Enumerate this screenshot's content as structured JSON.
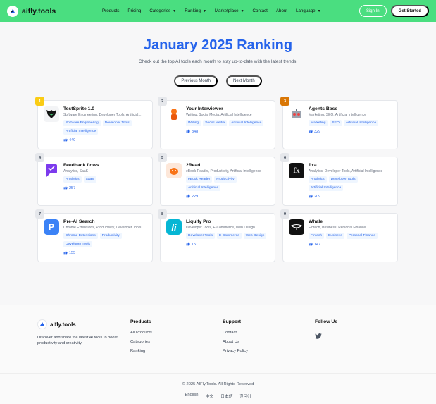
{
  "brand": {
    "name": "aifly.tools"
  },
  "nav": {
    "items": [
      {
        "label": "Products",
        "has_caret": false
      },
      {
        "label": "Pricing",
        "has_caret": false
      },
      {
        "label": "Categories",
        "has_caret": true
      },
      {
        "label": "Ranking",
        "has_caret": true
      },
      {
        "label": "Marketplace",
        "has_caret": true
      },
      {
        "label": "Contact",
        "has_caret": false
      },
      {
        "label": "About",
        "has_caret": false
      },
      {
        "label": "Language",
        "has_caret": true
      }
    ],
    "signin_label": "Sign In",
    "start_label": "Get Started"
  },
  "hero": {
    "title": "January 2025 Ranking",
    "subtitle": "Check out the top AI tools each month to stay up-to-date with the latest trends.",
    "prev_label": "Previous Month",
    "next_label": "Next Month"
  },
  "tools": [
    {
      "rank": "1",
      "name": "TestSprite 1.0",
      "categories": "Software Engineering, Developer Tools, Artificial...",
      "tags": [
        "Software Engineering",
        "Developer Tools",
        "Artificial Intelligence"
      ],
      "likes": "440",
      "icon": "testsprite-icon"
    },
    {
      "rank": "2",
      "name": "Your Interviewer",
      "categories": "Writing, Social Media, Artificial Intelligence",
      "tags": [
        "Writing",
        "Social Media",
        "Artificial Intelligence"
      ],
      "likes": "348",
      "icon": "interviewer-icon"
    },
    {
      "rank": "3",
      "name": "Agents Base",
      "categories": "Marketing, SEO, Artificial Intelligence",
      "tags": [
        "Marketing",
        "SEO",
        "Artificial Intelligence"
      ],
      "likes": "329",
      "icon": "robot-icon"
    },
    {
      "rank": "4",
      "name": "Feedback flows",
      "categories": "Analytics, SaaS",
      "tags": [
        "Analytics",
        "SaaS"
      ],
      "likes": "257",
      "icon": "feedback-icon"
    },
    {
      "rank": "5",
      "name": "2Read",
      "categories": "eBook Reader, Productivity, Artificial Intelligence",
      "tags": [
        "eBook Reader",
        "Productivity",
        "Artificial Intelligence"
      ],
      "likes": "229",
      "icon": "2read-icon"
    },
    {
      "rank": "6",
      "name": "fixa",
      "categories": "Analytics, Developer Tools, Artificial Intelligence",
      "tags": [
        "Analytics",
        "Developer Tools",
        "Artificial Intelligence"
      ],
      "likes": "209",
      "icon": "fixa-icon"
    },
    {
      "rank": "7",
      "name": "Pre-AI Search",
      "categories": "Chrome Extensions, Productivity, Developer Tools",
      "tags": [
        "Chrome Extensions",
        "Productivity",
        "Developer Tools"
      ],
      "likes": "155",
      "icon": "preai-icon"
    },
    {
      "rank": "8",
      "name": "Liquify Pro",
      "categories": "Developer Tools, E-Commerce, Web Design",
      "tags": [
        "Developer Tools",
        "E-Commerce",
        "Web Design"
      ],
      "likes": "151",
      "icon": "liquify-icon"
    },
    {
      "rank": "9",
      "name": "Whale",
      "categories": "Fintech, Business, Personal Finance",
      "tags": [
        "Fintech",
        "Business",
        "Personal Finance"
      ],
      "likes": "147",
      "icon": "whale-icon"
    }
  ],
  "footer": {
    "brand": "aifly.tools",
    "description": "Discover and share the latest AI tools to boost productivity and creativity.",
    "products_head": "Products",
    "products_links": [
      "All Products",
      "Categories",
      "Ranking"
    ],
    "support_head": "Support",
    "support_links": [
      "Contact",
      "About Us",
      "Privacy Policy"
    ],
    "follow_head": "Follow Us",
    "copyright": "© 2025 AIFly.Tools. All Rights Reserved",
    "languages": [
      "English",
      "中文",
      "日本語",
      "한국어"
    ]
  },
  "colors": {
    "header": "#4ade80",
    "accent": "#2563eb",
    "gold": "#facc15",
    "bronze": "#d97706"
  }
}
